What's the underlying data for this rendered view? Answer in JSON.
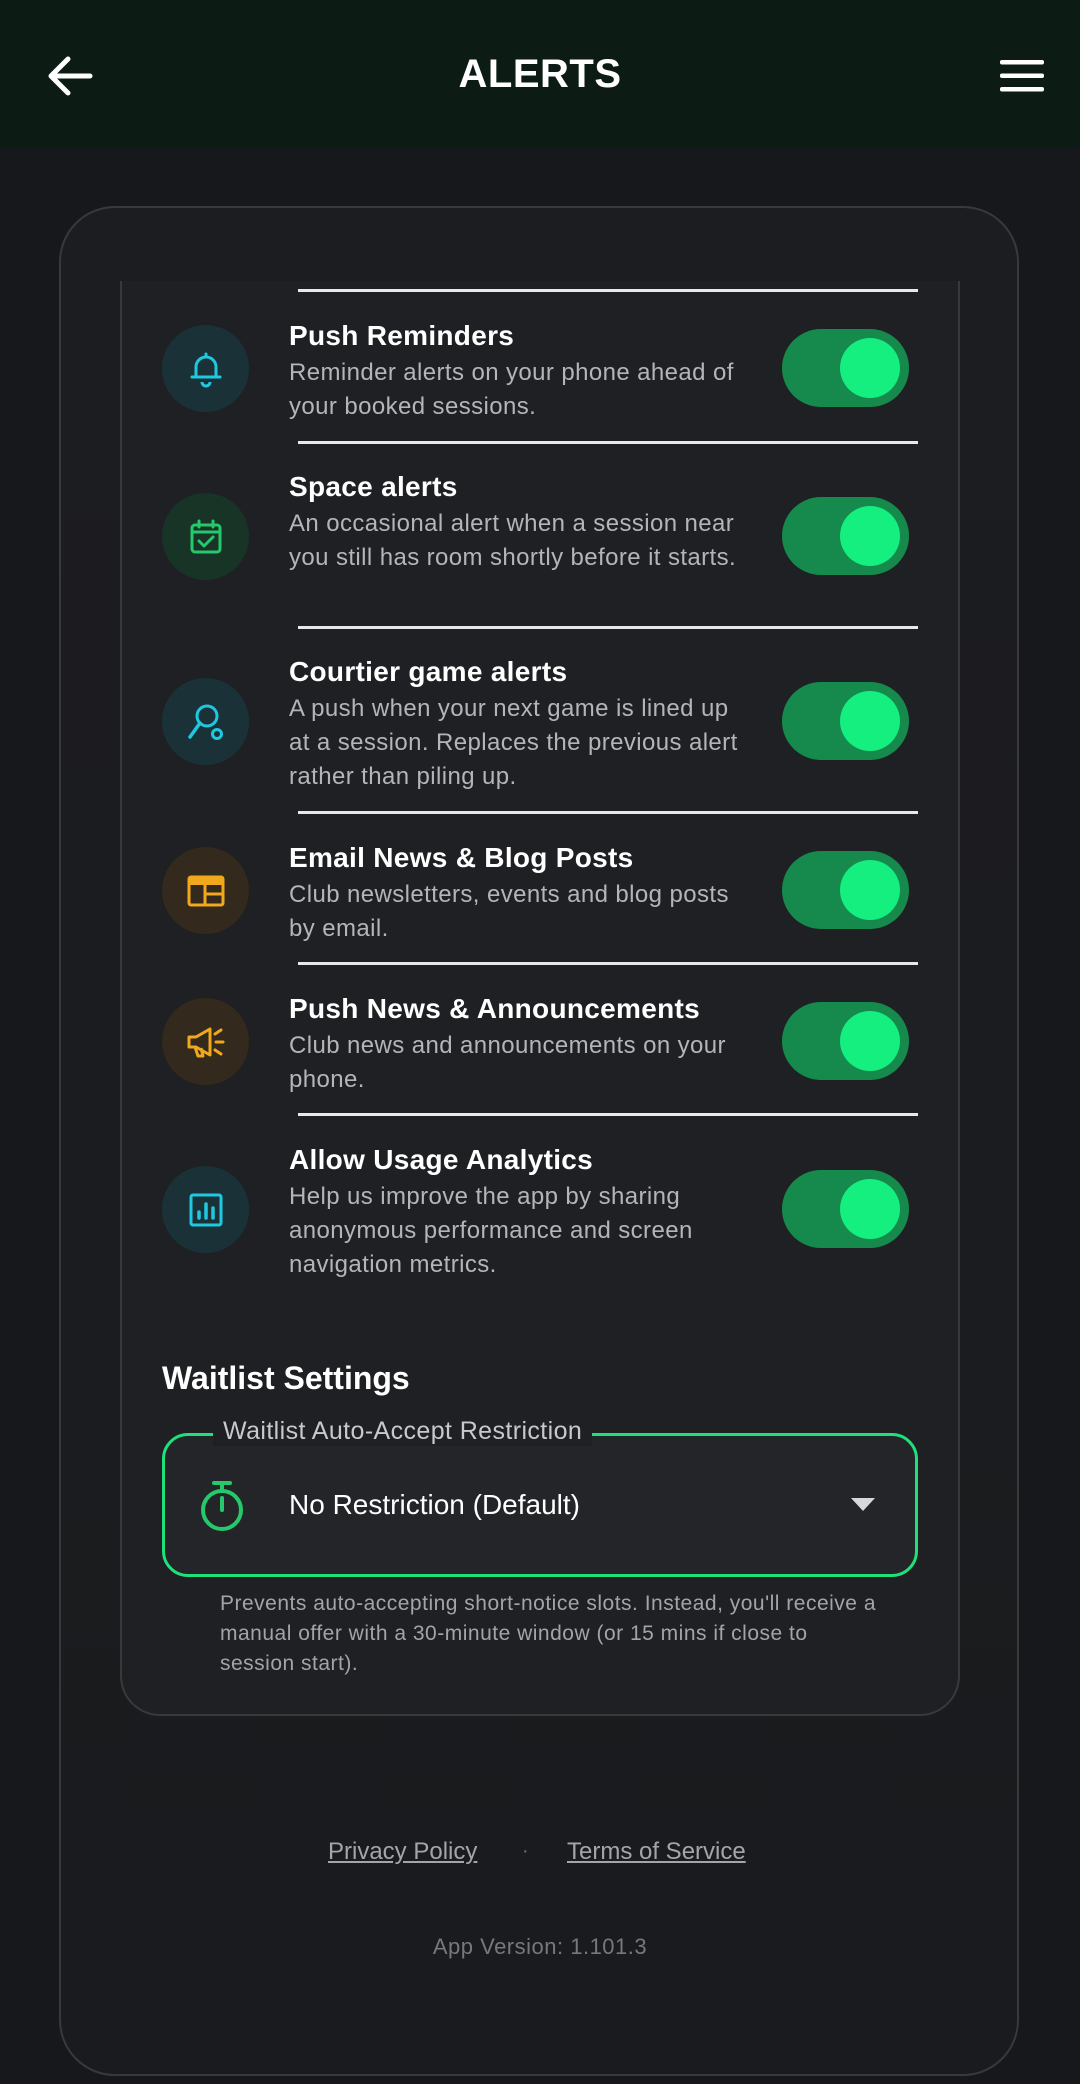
{
  "header": {
    "title": "ALERTS"
  },
  "alerts": [
    {
      "title": "Push Reminders",
      "desc": "Reminder alerts on your phone ahead of your booked sessions.",
      "icon": "bell-icon",
      "enabled": true
    },
    {
      "title": "Space alerts",
      "desc": "An occasional alert when a session near you still has room shortly before it starts.",
      "icon": "calendar-check-icon",
      "enabled": true
    },
    {
      "title": "Courtier game alerts",
      "desc": "A push when your next game is lined up at a session. Replaces the previous alert rather than piling up.",
      "icon": "racket-icon",
      "enabled": true
    },
    {
      "title": "Email News & Blog Posts",
      "desc": "Club newsletters, events and blog posts by email.",
      "icon": "newspaper-icon",
      "enabled": true
    },
    {
      "title": "Push News & Announcements",
      "desc": "Club news and announcements on your phone.",
      "icon": "megaphone-icon",
      "enabled": true
    },
    {
      "title": "Allow Usage Analytics",
      "desc": "Help us improve the app by sharing anonymous performance and screen navigation metrics.",
      "icon": "analytics-icon",
      "enabled": true
    }
  ],
  "waitlist": {
    "section_title": "Waitlist Settings",
    "field_label": "Waitlist Auto-Accept Restriction",
    "selected": "No Restriction (Default)",
    "help": "Prevents auto-accepting short-notice slots. Instead, you'll receive a manual offer with a 30-minute window (or 15 mins if close to session start)."
  },
  "footer": {
    "privacy": "Privacy Policy",
    "separator": "·",
    "terms": "Terms of Service",
    "version": "App Version: 1.101.3"
  },
  "colors": {
    "accent": "#14ef7f",
    "toggle_track": "#168a4c",
    "cyan": "#1ec8e0",
    "green": "#25c86a",
    "amber": "#f2a81d"
  }
}
